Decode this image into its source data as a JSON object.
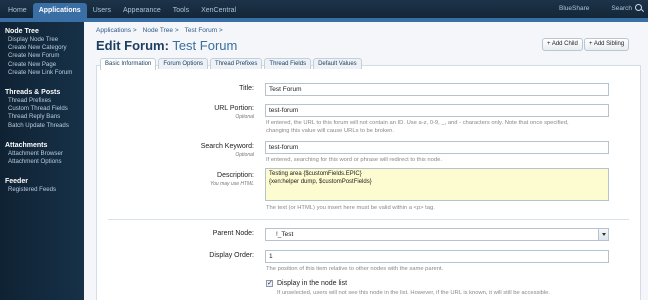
{
  "topnav": {
    "items": [
      "Home",
      "Applications",
      "Users",
      "Appearance",
      "Tools",
      "XenCentral"
    ],
    "active": "Applications",
    "right_items": [
      "BlueShare",
      "Search"
    ]
  },
  "sidebar": {
    "sections": [
      {
        "title": "Node Tree",
        "items": [
          "Display Node Tree",
          "Create New Category",
          "Create New Forum",
          "Create New Page",
          "Create New Link Forum"
        ]
      },
      {
        "title": "Threads & Posts",
        "items": [
          "Thread Prefixes",
          "Custom Thread Fields",
          "Thread Reply Bans",
          "Batch Update Threads"
        ]
      },
      {
        "title": "Attachments",
        "items": [
          "Attachment Browser",
          "Attachment Options"
        ]
      },
      {
        "title": "Feeder",
        "items": [
          "Registered Feeds"
        ]
      }
    ]
  },
  "breadcrumb": [
    "Applications >",
    "Node Tree >",
    "Test Forum >"
  ],
  "page": {
    "title_prefix": "Edit Forum:",
    "title_name": "Test Forum",
    "add_child": "+ Add Child",
    "add_sibling": "+ Add Sibling"
  },
  "tabs": [
    "Basic Information",
    "Forum Options",
    "Thread Prefixes",
    "Thread Fields",
    "Default Values"
  ],
  "form": {
    "title_label": "Title:",
    "title_value": "Test Forum",
    "url_label": "URL Portion:",
    "url_optional": "Optional",
    "url_value": "test-forum",
    "url_hint_1": "If entered, the URL to this forum will not contain an ID. Use a-z, 0-9, _, and - characters only. Note that once specified,",
    "url_hint_2": "changing this value will cause URLs to be broken.",
    "keyword_label": "Search Keyword:",
    "keyword_optional": "Optional",
    "keyword_value": "test-forum",
    "keyword_hint": "If entered, searching for this word or phrase will redirect to this node.",
    "desc_label": "Description:",
    "desc_sub": "You may use HTML",
    "desc_line_1": "Testing area {$customFields.EPIC}",
    "desc_line_2": "{xen:helper dump, $customPostFields}",
    "desc_hint": "The text (or HTML) you insert here must be valid within a <p> tag.",
    "parent_label": "Parent Node:",
    "parent_value": "!_Test",
    "order_label": "Display Order:",
    "order_value": "1",
    "order_hint": "The position of this item relative to other nodes with the same parent.",
    "display_label": "Display in the node list",
    "display_hint": "If unselected, users will not see this node in the list. However, if the URL is known, it will still be accessible."
  }
}
